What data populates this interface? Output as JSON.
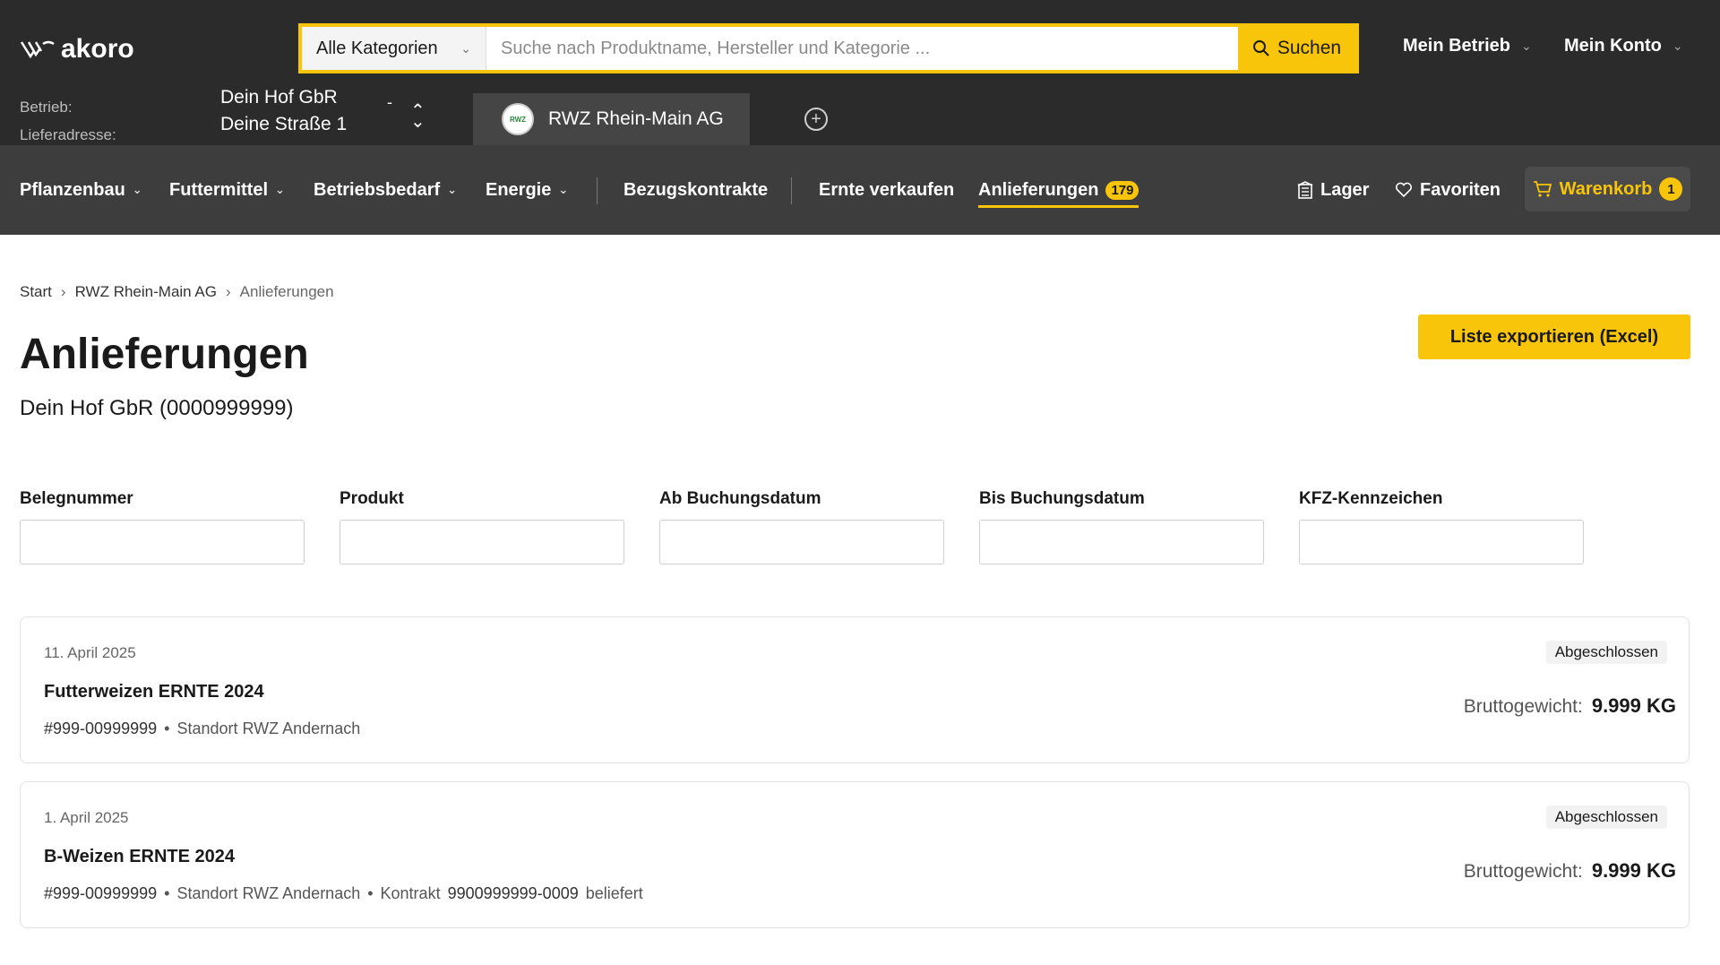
{
  "header": {
    "logo_text": "akoro",
    "search": {
      "category": "Alle Kategorien",
      "placeholder": "Suche nach Produktname, Hersteller und Kategorie ...",
      "button_label": "Suchen"
    },
    "menus": [
      "Mein Betrieb",
      "Mein Konto"
    ],
    "betrieb_label": "Betrieb:",
    "lieferadresse_label": "Lieferadresse:",
    "betrieb_name": "Dein Hof GbR",
    "betrieb_address": "Deine Straße 1",
    "betrieb_dash": "-",
    "supplier_name": "RWZ Rhein-Main AG",
    "supplier_logo_text": "RWZ"
  },
  "nav": {
    "items": [
      {
        "label": "Pflanzenbau"
      },
      {
        "label": "Futtermittel"
      },
      {
        "label": "Betriebsbedarf"
      },
      {
        "label": "Energie"
      },
      {
        "label": "Bezugskontrakte"
      },
      {
        "label": "Ernte verkaufen"
      },
      {
        "label": "Anlieferungen",
        "badge": "179"
      }
    ],
    "lager": "Lager",
    "favoriten": "Favoriten",
    "warenkorb": "Warenkorb",
    "warenkorb_count": "1"
  },
  "breadcrumb": [
    "Start",
    "RWZ Rhein-Main AG",
    "Anlieferungen"
  ],
  "page": {
    "title": "Anlieferungen",
    "subtitle": "Dein Hof GbR (0000999999)",
    "export_label": "Liste exportieren (Excel)"
  },
  "filters": [
    {
      "label": "Belegnummer",
      "value": ""
    },
    {
      "label": "Produkt",
      "value": ""
    },
    {
      "label": "Ab Buchungsdatum",
      "value": ""
    },
    {
      "label": "Bis Buchungsdatum",
      "value": ""
    },
    {
      "label": "KFZ-Kennzeichen",
      "value": ""
    }
  ],
  "deliveries": [
    {
      "date": "11. April 2025",
      "product": "Futterweizen ERNTE 2024",
      "id": "#999-00999999",
      "location": "Standort RWZ Andernach",
      "status": "Abgeschlossen",
      "weight_label": "Bruttogewicht:",
      "weight_value": "9.999 KG"
    },
    {
      "date": "1. April 2025",
      "product": "B-Weizen ERNTE 2024",
      "id": "#999-00999999",
      "location": "Standort RWZ Andernach",
      "contract_label": "Kontrakt",
      "contract_id": "9900999999-0009",
      "contract_suffix": "beliefert",
      "status": "Abgeschlossen",
      "weight_label": "Bruttogewicht:",
      "weight_value": "9.999 KG"
    }
  ],
  "colors": {
    "accent": "#f9c50a",
    "header_bg": "#2b2b2b",
    "nav_bg": "#3d3d3d"
  }
}
